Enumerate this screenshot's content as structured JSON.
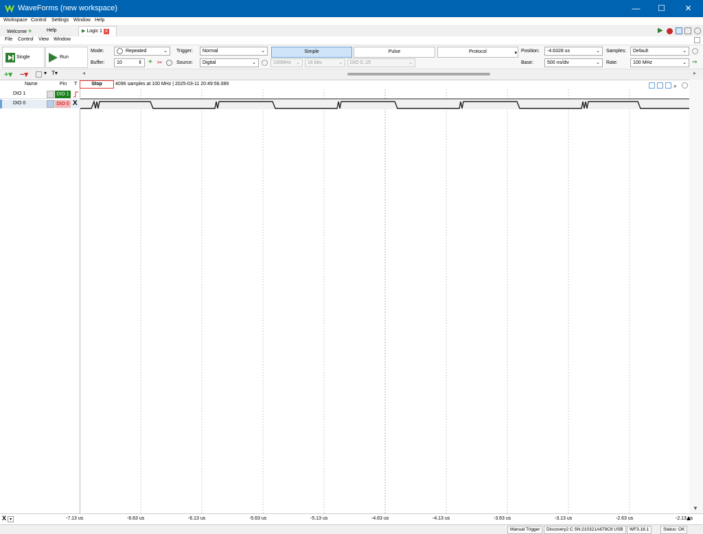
{
  "window": {
    "title": "WaveForms (new workspace)",
    "min": "—",
    "max": "☐",
    "close": "✕"
  },
  "menu1": [
    "Workspace",
    "Control",
    "Settings",
    "Window",
    "Help"
  ],
  "tabs": {
    "welcome": "Welcome",
    "help": "Help",
    "logic": "Logic 1"
  },
  "menu2": [
    "File",
    "Control",
    "View",
    "Window"
  ],
  "toolbar": {
    "single": "Single",
    "run": "Run",
    "mode_label": "Mode:",
    "mode_value": "Repeated",
    "buffer_label": "Buffer:",
    "buffer_value": "10",
    "trigger_label": "Trigger:",
    "trigger_value": "Normal",
    "source_label": "Source:",
    "source_value": "Digital",
    "freq_value": "100MHz",
    "bits_value": "16 bits",
    "dio_value": "DIO 0..15",
    "seg_simple": "Simple",
    "seg_pulse": "Pulse",
    "seg_protocol": "Protocol",
    "position_label": "Position:",
    "position_value": "-4.6328 us",
    "base_label": "Base:",
    "base_value": "500 ns/div",
    "samples_label": "Samples:",
    "samples_value": "Default",
    "rate_label": "Rate:",
    "rate_value": "100 MHz"
  },
  "channels": {
    "name_header": "Name",
    "pin_header": "Pin",
    "t_header": "T",
    "rows": [
      {
        "name": "DIO 1",
        "pin": "DIO 1",
        "pin_color": "#1a7f1a",
        "pin_text_color": "#ffffff"
      },
      {
        "name": "DIO 0",
        "pin": "DIO 0",
        "pin_color": "#f5b7b7",
        "pin_text_color": "#c00000"
      }
    ]
  },
  "acquisition": {
    "stop": "Stop",
    "info": "4096 samples at 100 MHz | 2025-03-11 20:49:56.089"
  },
  "axis": {
    "ticks": [
      "-7.13 us",
      "-6.63 us",
      "-6.13 us",
      "-5.63 us",
      "-5.13 us",
      "-4.63 us",
      "-4.13 us",
      "-3.63 us",
      "-3.13 us",
      "-2.63 us",
      "-2.13 us"
    ]
  },
  "status": {
    "manual_trigger": "Manual Trigger",
    "device": "Discovery2 C SN:210321A679C8 USB",
    "version": "WF3.18.1",
    "status": "Status: OK"
  },
  "colors": {
    "titlebar": "#0063b1",
    "stop_border": "#e53935",
    "seg_selected": "#cfe4f7"
  }
}
